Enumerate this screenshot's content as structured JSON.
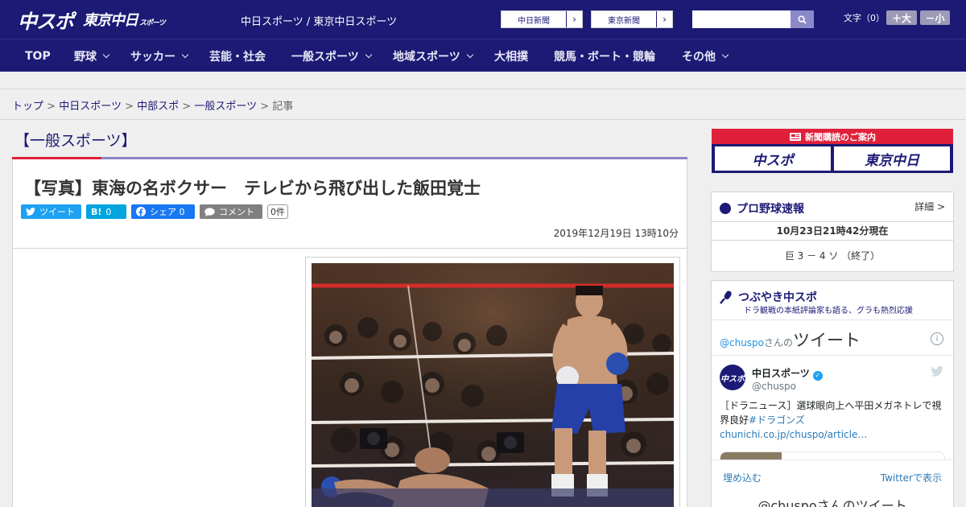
{
  "header": {
    "logo_main": "中スポ",
    "logo_sub": "東京中日",
    "logo_sub_small": "スポーツ",
    "site_names": "中日スポーツ / 東京中日スポーツ",
    "newspaper_buttons": [
      "中日新聞",
      "東京新聞"
    ],
    "search_placeholder": "",
    "font_size_label": "文字（0）",
    "font_increase": "＋大",
    "font_decrease": "－小"
  },
  "nav": {
    "items": [
      "TOP",
      "野球",
      "サッカー",
      "芸能・社会",
      "一般スポーツ",
      "地域スポーツ",
      "大相撲",
      "競馬・ボート・競輪",
      "その他"
    ]
  },
  "breadcrumb": {
    "items": [
      "トップ",
      "中日スポーツ",
      "中部スポ",
      "一般スポーツ"
    ],
    "separator": ">",
    "current": "記事"
  },
  "article": {
    "section": "【一般スポーツ】",
    "title": "【写真】東海の名ボクサー　テレビから飛び出した飯田覚士",
    "share": {
      "tweet": "ツイート",
      "hatena_label": "B!",
      "hatena_count": "0",
      "facebook": "シェア",
      "facebook_count": "0",
      "comment": "コメント",
      "comment_count": "0件"
    },
    "date": "2019年12月19日 13時10分"
  },
  "sidebar": {
    "ad": {
      "top": "新聞購読のご案内",
      "left": "中スポ",
      "right": "東京中日"
    },
    "baseball": {
      "title": "プロ野球速報",
      "detail": "詳細 >",
      "as_of": "10月23日21時42分現在",
      "score": "巨 3 － 4 ソ （終了）"
    },
    "twitter": {
      "title": "つぶやき中スポ",
      "subtitle": "ドラ観戦の本紙評論家も語る、グラも熱烈応援",
      "handle": "@chuspo",
      "handle_suffix": "さんの",
      "heading": "ツイート",
      "info": "i",
      "account_name": "中日スポーツ",
      "account_id": "@chuspo",
      "avatar_text": "中スポ",
      "tweet_text": "［ドラニュース］選球眼向上へ平田メガネトレで視界良好",
      "tweet_hashtag": "#ドラゴンズ",
      "tweet_link": "chunichi.co.jp/chuspo/article…",
      "embed": "埋め込む",
      "view_on": "Twitterで表示",
      "bottom": "@chuspoさんのツイート"
    }
  },
  "colors": {
    "brand_navy": "#1c1a75",
    "accent_red": "#e0203a",
    "twitter_blue": "#1da1f2",
    "facebook_blue": "#1877f2",
    "hatena_blue": "#00a4de"
  }
}
